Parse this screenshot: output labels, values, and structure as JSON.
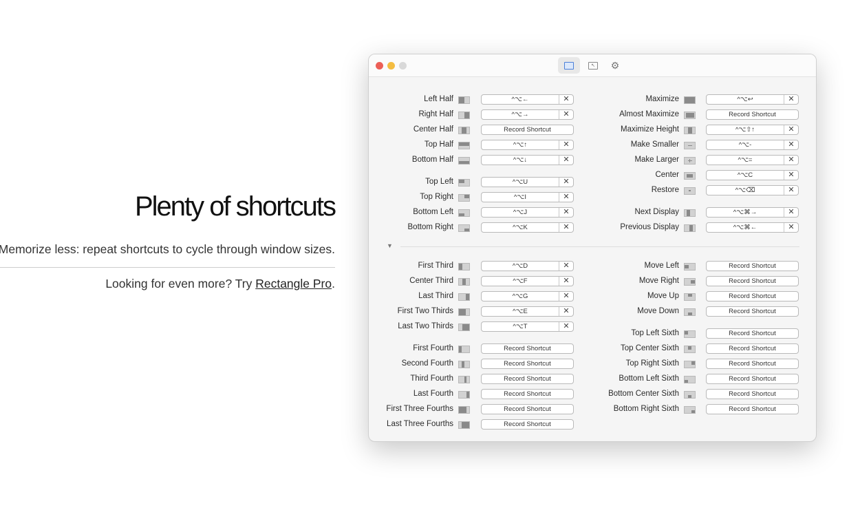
{
  "hero": {
    "title": "Plenty of shortcuts",
    "subtitle": "Memorize less: repeat shortcuts to cycle through window sizes.",
    "more_prefix": "Looking for even more? Try ",
    "more_link": "Rectangle Pro",
    "more_suffix": "."
  },
  "window": {
    "traffic_lights": {
      "close": "#ec5f57",
      "minimize": "#f4bd41",
      "zoom": "#d9d9d9"
    },
    "toolbar": [
      {
        "icon": "window-shortcuts-icon",
        "active": true
      },
      {
        "icon": "snap-areas-icon",
        "active": false
      },
      {
        "icon": "settings-gear-icon",
        "active": false
      }
    ],
    "record_label": "Record Shortcut",
    "clear_glyph": "✕",
    "disclosure_glyph": "▼",
    "left_top": [
      [
        {
          "label": "Left Half",
          "icon": "left-half",
          "shortcut": "^⌥←"
        },
        {
          "label": "Right Half",
          "icon": "right-half",
          "shortcut": "^⌥→"
        },
        {
          "label": "Center Half",
          "icon": "center-half",
          "shortcut": ""
        },
        {
          "label": "Top Half",
          "icon": "top-half",
          "shortcut": "^⌥↑"
        },
        {
          "label": "Bottom Half",
          "icon": "bottom-half",
          "shortcut": "^⌥↓"
        }
      ],
      [
        {
          "label": "Top Left",
          "icon": "top-left",
          "shortcut": "^⌥U"
        },
        {
          "label": "Top Right",
          "icon": "top-right",
          "shortcut": "^⌥I"
        },
        {
          "label": "Bottom Left",
          "icon": "bottom-left",
          "shortcut": "^⌥J"
        },
        {
          "label": "Bottom Right",
          "icon": "bottom-right",
          "shortcut": "^⌥K"
        }
      ]
    ],
    "right_top": [
      [
        {
          "label": "Maximize",
          "icon": "maximize",
          "shortcut": "^⌥↩"
        },
        {
          "label": "Almost Maximize",
          "icon": "almost-maximize",
          "shortcut": ""
        },
        {
          "label": "Maximize Height",
          "icon": "maximize-height",
          "shortcut": "^⌥⇧↑"
        },
        {
          "label": "Make Smaller",
          "icon": "make-smaller",
          "shortcut": "^⌥-"
        },
        {
          "label": "Make Larger",
          "icon": "make-larger",
          "shortcut": "^⌥="
        },
        {
          "label": "Center",
          "icon": "center",
          "shortcut": "^⌥C"
        },
        {
          "label": "Restore",
          "icon": "restore",
          "shortcut": "^⌥⌫"
        }
      ],
      [
        {
          "label": "Next Display",
          "icon": "next-display",
          "shortcut": "^⌥⌘→"
        },
        {
          "label": "Previous Display",
          "icon": "previous-display",
          "shortcut": "^⌥⌘←"
        }
      ]
    ],
    "left_bottom": [
      [
        {
          "label": "First Third",
          "icon": "first-third",
          "shortcut": "^⌥D"
        },
        {
          "label": "Center Third",
          "icon": "center-third",
          "shortcut": "^⌥F"
        },
        {
          "label": "Last Third",
          "icon": "last-third",
          "shortcut": "^⌥G"
        },
        {
          "label": "First Two Thirds",
          "icon": "first-two-thirds",
          "shortcut": "^⌥E"
        },
        {
          "label": "Last Two Thirds",
          "icon": "last-two-thirds",
          "shortcut": "^⌥T"
        }
      ],
      [
        {
          "label": "First Fourth",
          "icon": "first-fourth",
          "shortcut": ""
        },
        {
          "label": "Second Fourth",
          "icon": "second-fourth",
          "shortcut": ""
        },
        {
          "label": "Third Fourth",
          "icon": "third-fourth",
          "shortcut": ""
        },
        {
          "label": "Last Fourth",
          "icon": "last-fourth",
          "shortcut": ""
        },
        {
          "label": "First Three Fourths",
          "icon": "first-three-fourths",
          "shortcut": ""
        },
        {
          "label": "Last Three Fourths",
          "icon": "last-three-fourths",
          "shortcut": ""
        }
      ]
    ],
    "right_bottom": [
      [
        {
          "label": "Move Left",
          "icon": "move-left",
          "shortcut": ""
        },
        {
          "label": "Move Right",
          "icon": "move-right",
          "shortcut": ""
        },
        {
          "label": "Move Up",
          "icon": "move-up",
          "shortcut": ""
        },
        {
          "label": "Move Down",
          "icon": "move-down",
          "shortcut": ""
        }
      ],
      [
        {
          "label": "Top Left Sixth",
          "icon": "top-left-sixth",
          "shortcut": ""
        },
        {
          "label": "Top Center Sixth",
          "icon": "top-center-sixth",
          "shortcut": ""
        },
        {
          "label": "Top Right Sixth",
          "icon": "top-right-sixth",
          "shortcut": ""
        },
        {
          "label": "Bottom Left Sixth",
          "icon": "bottom-left-sixth",
          "shortcut": ""
        },
        {
          "label": "Bottom Center Sixth",
          "icon": "bottom-center-sixth",
          "shortcut": ""
        },
        {
          "label": "Bottom Right Sixth",
          "icon": "bottom-right-sixth",
          "shortcut": ""
        }
      ]
    ]
  }
}
